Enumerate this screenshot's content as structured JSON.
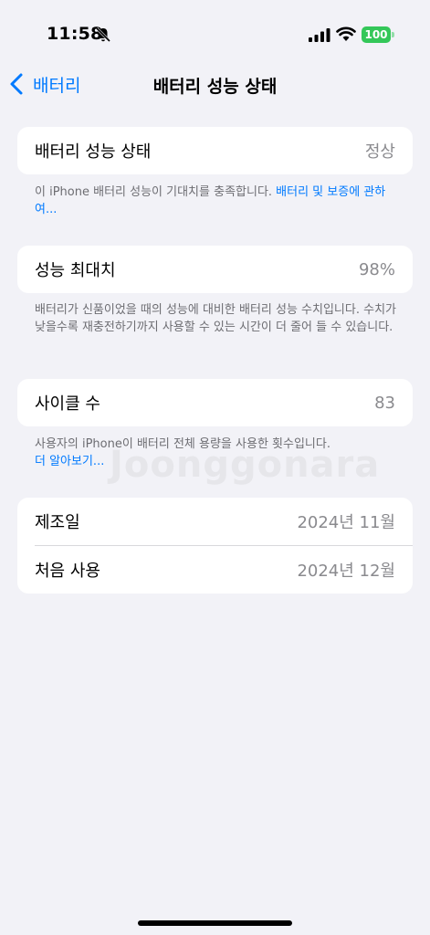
{
  "status_bar": {
    "time": "11:58",
    "battery_level": "100",
    "icons": [
      "bell-off-icon",
      "signal-icon",
      "wifi-icon",
      "battery-icon"
    ],
    "battery_color": "#34c759"
  },
  "nav": {
    "back_label": "배터리",
    "title": "배터리 성능 상태",
    "accent_color": "#007aff"
  },
  "sections": {
    "health": {
      "label": "배터리 성능 상태",
      "value": "정상",
      "footer_text": "이 iPhone 배터리 성능이 기대치를 충족합니다. ",
      "footer_link": "배터리 및 보증에 관하여..."
    },
    "capacity": {
      "label": "성능 최대치",
      "value": "98%",
      "footer_text": "배터리가 신품이었을 때의 성능에 대비한 배터리 성능 수치입니다. 수치가 낮을수록 재충전하기까지 사용할 수 있는 시간이 더 줄어 들 수 있습니다."
    },
    "cycles": {
      "label": "사이클 수",
      "value": "83",
      "footer_text": "사용자의 iPhone이 배터리 전체 용량을 사용한 횟수입니다.",
      "footer_link": "더 알아보기..."
    },
    "dates": {
      "manufactured_label": "제조일",
      "manufactured_value": "2024년 11월",
      "first_use_label": "처음 사용",
      "first_use_value": "2024년 12월"
    }
  },
  "watermark": "Joonggonara"
}
